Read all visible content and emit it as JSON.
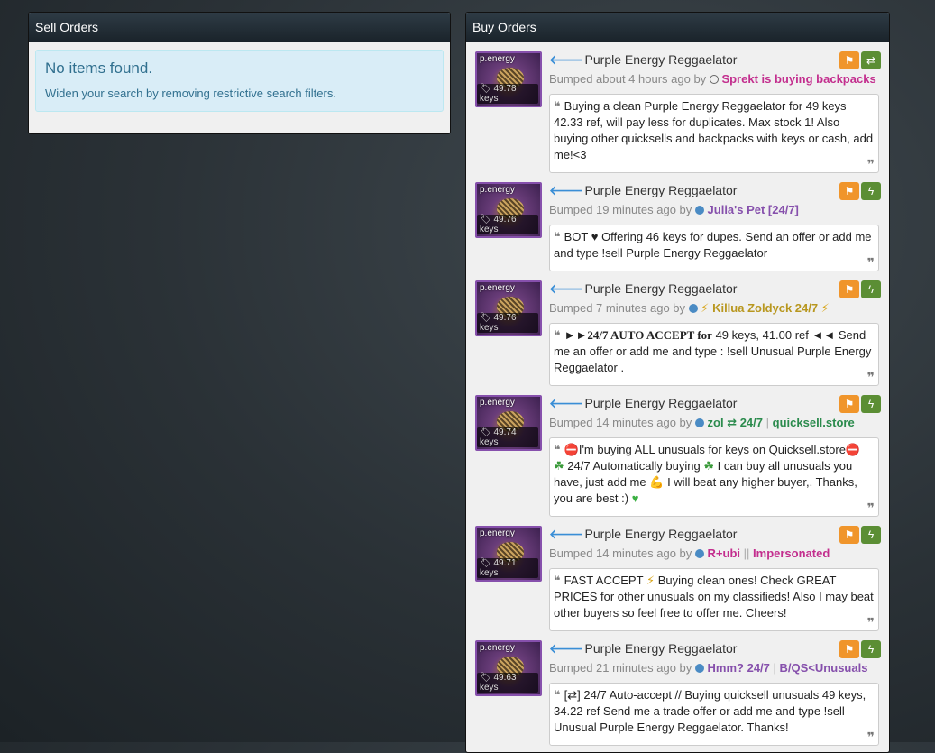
{
  "sell_panel": {
    "title": "Sell Orders",
    "empty_title": "No items found.",
    "empty_hint": "Widen your search by removing restrictive search filters."
  },
  "buy_panel": {
    "title": "Buy Orders"
  },
  "orders": [
    {
      "item_tag": "p.energy",
      "price": "49.78 keys",
      "item_name": "Purple Energy Reggaelator",
      "bumped": "Bumped about 4 hours ago by",
      "user": "Sprekt is buying backpacks",
      "message": "Buying a clean Purple Energy Reggaelator for 49 keys 42.33 ref, will pay less for duplicates. Max stock 1! Also buying other quicksells and backpacks with keys or cash, add me!<3"
    },
    {
      "item_tag": "p.energy",
      "price": "49.76 keys",
      "item_name": "Purple Energy Reggaelator",
      "bumped": "Bumped 19 minutes ago by",
      "user": "Julia's Pet [24/7]",
      "message": "BOT ♥ Offering 46 keys for dupes. Send an offer or add me and type !sell Purple Energy Reggaelator"
    },
    {
      "item_tag": "p.energy",
      "price": "49.76 keys",
      "item_name": "Purple Energy Reggaelator",
      "bumped": "Bumped 7 minutes ago by",
      "user": "Killua Zoldyck 24/7",
      "message_prefix": "►►24/7 AUTO ACCEPT for",
      "message": "49 keys, 41.00 ref ◄◄ Send me an offer or add me and type : !sell Unusual Purple Energy Reggaelator ."
    },
    {
      "item_tag": "p.energy",
      "price": "49.74 keys",
      "item_name": "Purple Energy Reggaelator",
      "bumped": "Bumped 14 minutes ago by",
      "user": "zol ⇄ 24/7",
      "user_site": "quicksell.store",
      "message_a": "I'm buying ALL unusuals for keys on Quicksell.store",
      "message_b": "24/7 Automatically buying",
      "message_c": "I can buy all unusuals you have, just add me",
      "message_d": "I will beat any higher buyer,. Thanks, you are best :)"
    },
    {
      "item_tag": "p.energy",
      "price": "49.71 keys",
      "item_name": "Purple Energy Reggaelator",
      "bumped": "Bumped 14 minutes ago by",
      "user": "R+ubi",
      "user_extra": "Impersonated",
      "message_a": "FAST ACCEPT",
      "message_b": "Buying clean ones! Check GREAT PRICES for other unusuals on my classifieds! Also I may beat other buyers so feel free to offer me. Cheers!"
    },
    {
      "item_tag": "p.energy",
      "price": "49.63 keys",
      "item_name": "Purple Energy Reggaelator",
      "bumped": "Bumped 21 minutes ago by",
      "user": "Hmm? 24/7",
      "user_extra": "B/QS<Unusuals",
      "message": "[⇄] 24/7 Auto-accept // Buying quicksell unusuals 49 keys, 34.22 ref Send me a trade offer or add me and type !sell Unusual Purple Energy Reggaelator. Thanks!"
    }
  ]
}
